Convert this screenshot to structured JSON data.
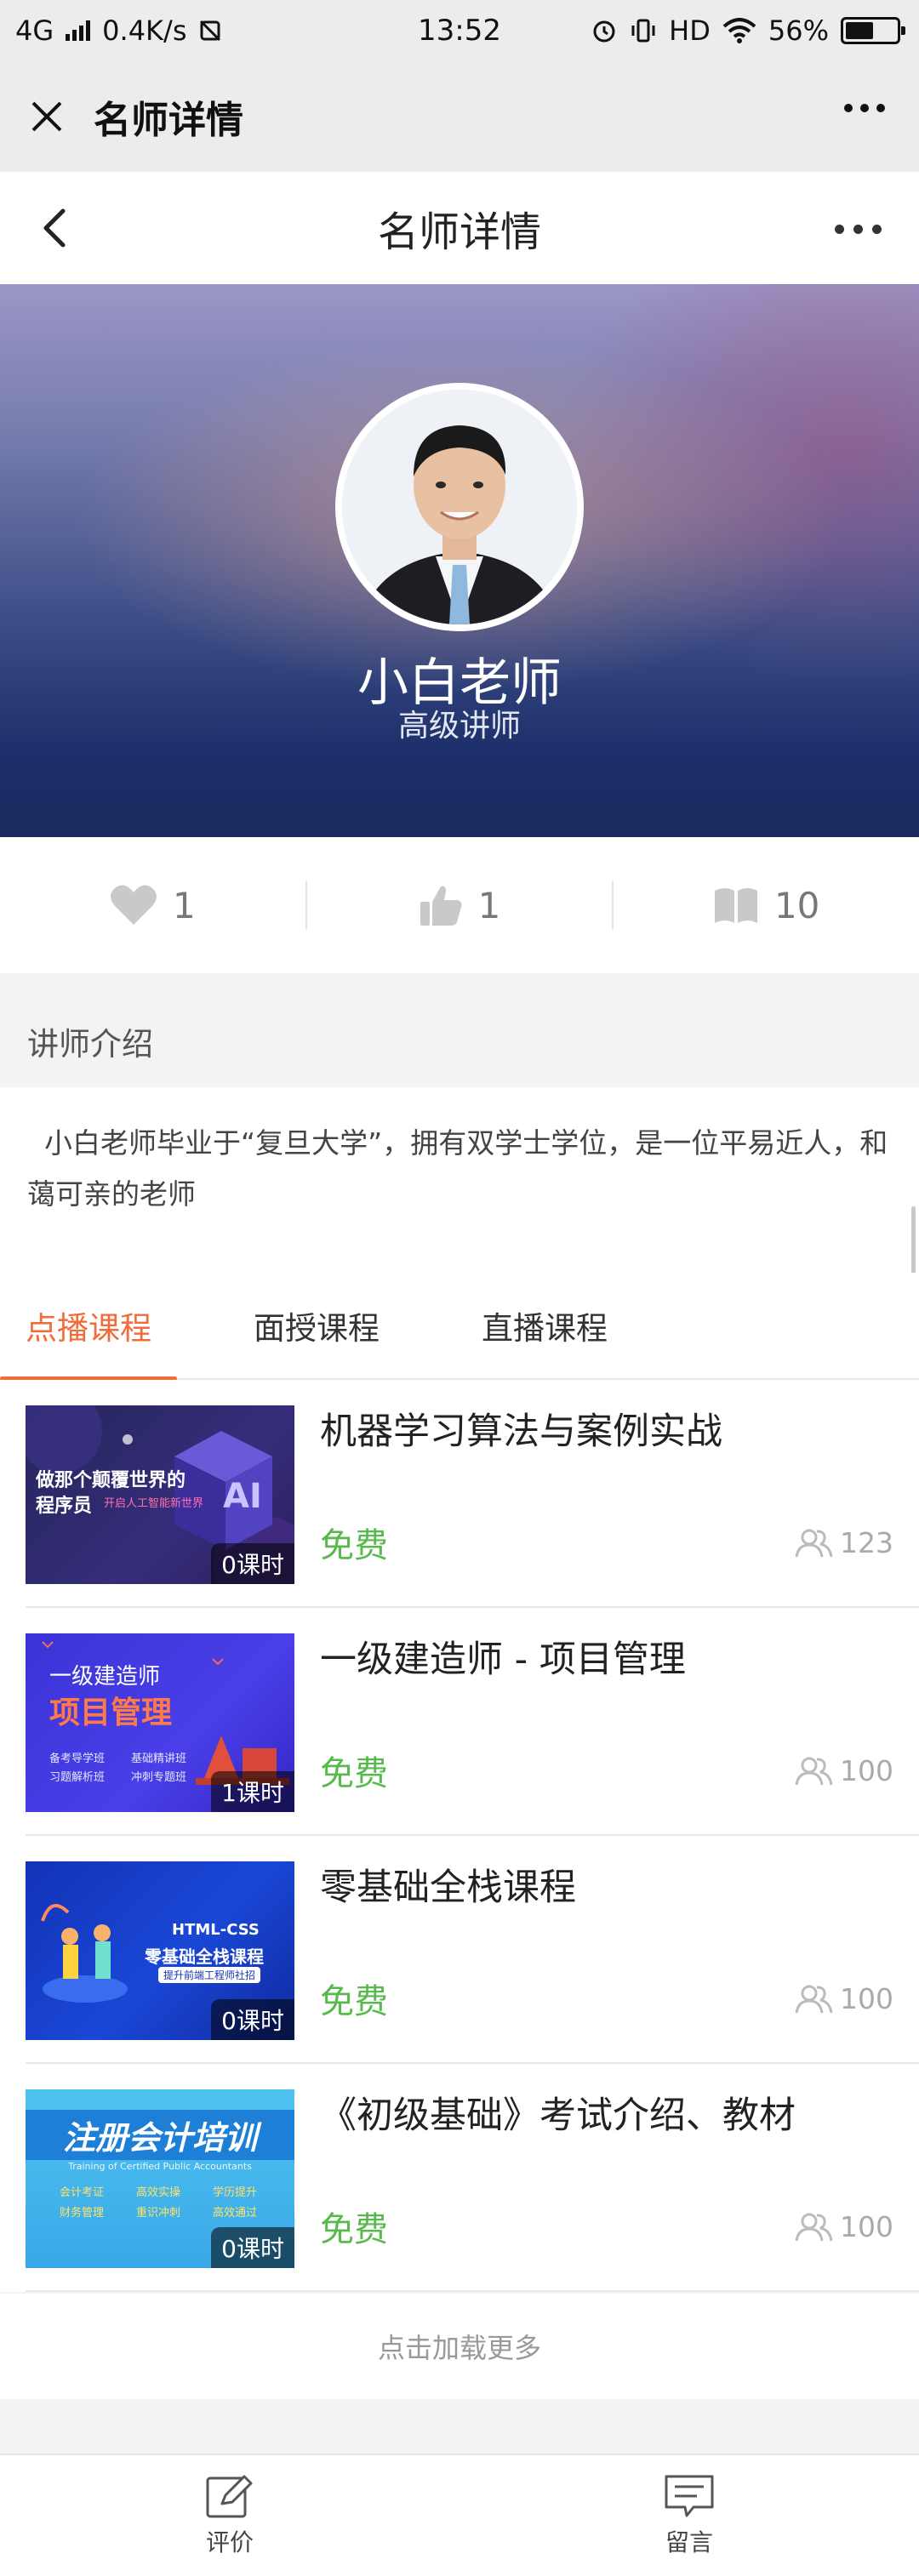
{
  "status_bar": {
    "network": "4G",
    "speed": "0.4K/s",
    "time": "13:52",
    "hd": "HD",
    "battery_pct": "56%",
    "battery_level": 0.56
  },
  "wechat_bar": {
    "title": "名师详情"
  },
  "header": {
    "title": "名师详情"
  },
  "teacher": {
    "name": "小白老师",
    "title": "高级讲师"
  },
  "stats": {
    "favorites": "1",
    "likes": "1",
    "courses": "10"
  },
  "intro": {
    "heading": "讲师介绍",
    "text": "小白老师毕业于“复旦大学”，拥有双学士学位，是一位平易近人，和蔼可亲的老师"
  },
  "tabs": [
    {
      "label": "点播课程",
      "active": true
    },
    {
      "label": "面授课程",
      "active": false
    },
    {
      "label": "直播课程",
      "active": false
    }
  ],
  "courses": [
    {
      "title": "机器学习算法与案例实战",
      "price": "免费",
      "learners": "123",
      "lessons": "0课时",
      "thumb_lines": [
        "做那个颠覆世界的",
        "程序员",
        "开启人工智能新世界"
      ]
    },
    {
      "title": "一级建造师 - 项目管理",
      "price": "免费",
      "learners": "100",
      "lessons": "1课时",
      "thumb_lines": [
        "一级建造师",
        "项目管理",
        "备考导学班",
        "基础精讲班",
        "习题解析班",
        "冲刺专题班"
      ]
    },
    {
      "title": "零基础全栈课程",
      "price": "免费",
      "learners": "100",
      "lessons": "0课时",
      "thumb_lines": [
        "HTML-CSS",
        "零基础全栈课程",
        "提升前端工程师社招"
      ]
    },
    {
      "title": "《初级基础》考试介绍、教材",
      "price": "免费",
      "learners": "100",
      "lessons": "0课时",
      "thumb_lines": [
        "注册会计培训",
        "Training of Certified Public Accountants",
        "会计考证",
        "高效实操",
        "学历提升",
        "财务管理",
        "重识冲刺",
        "高效通过"
      ]
    }
  ],
  "load_more": "点击加载更多",
  "bottom_bar": {
    "review": "评价",
    "message": "留言"
  },
  "colors": {
    "accent": "#f26b3a",
    "price": "#58b94c"
  }
}
